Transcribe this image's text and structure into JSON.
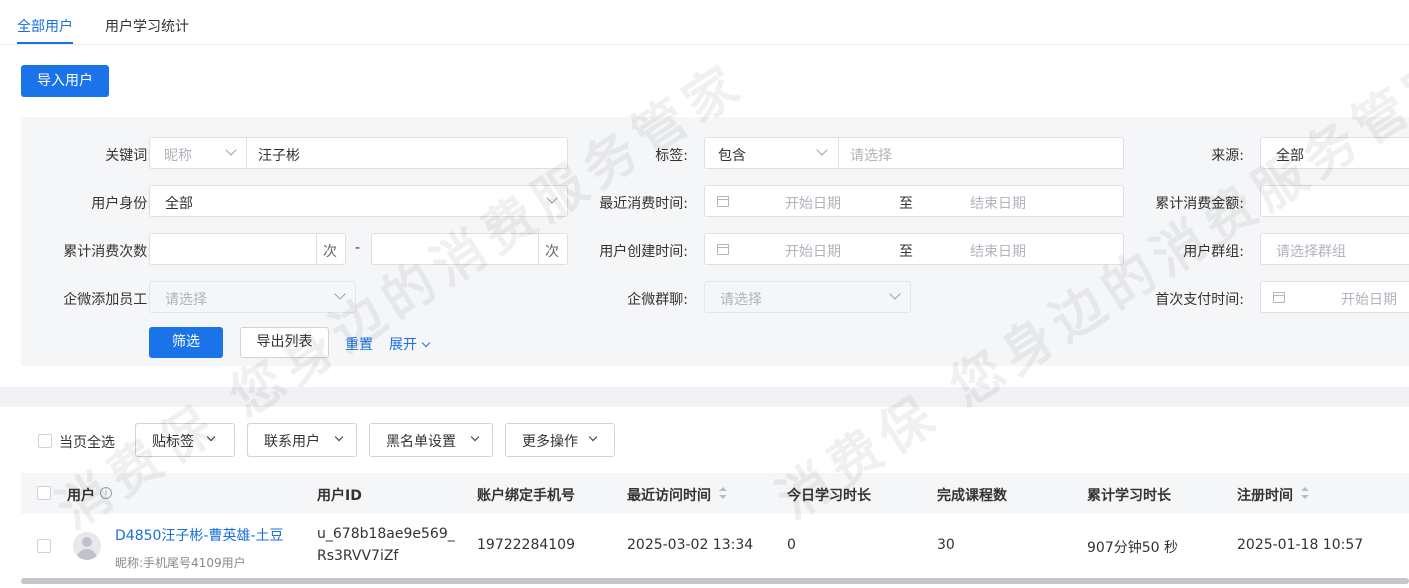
{
  "tabs": [
    {
      "label": "全部用户",
      "active": true
    },
    {
      "label": "用户学习统计",
      "active": false
    }
  ],
  "import_button": "导入用户",
  "filters": {
    "keyword": {
      "label": "关键词:",
      "type_value": "昵称",
      "value": "汪子彬"
    },
    "tag": {
      "label": "标签:",
      "mode": "包含",
      "placeholder": "请选择"
    },
    "source": {
      "label": "来源:",
      "value": "全部"
    },
    "identity": {
      "label": "用户身份:",
      "value": "全部"
    },
    "last_consume_time": {
      "label": "最近消费时间:",
      "start": "开始日期",
      "sep": "至",
      "end": "结束日期"
    },
    "total_consume_amount": {
      "label": "累计消费金额:"
    },
    "total_consume_count": {
      "label": "累计消费次数:",
      "unit": "次",
      "dash": "-"
    },
    "user_created_time": {
      "label": "用户创建时间:",
      "start": "开始日期",
      "sep": "至",
      "end": "结束日期"
    },
    "user_group": {
      "label": "用户群组:",
      "placeholder": "请选择群组"
    },
    "wecom_staff": {
      "label": "企微添加员工:",
      "placeholder": "请选择"
    },
    "wecom_group": {
      "label": "企微群聊:",
      "placeholder": "请选择"
    },
    "first_pay_time": {
      "label": "首次支付时间:",
      "start": "开始日期"
    }
  },
  "actions": {
    "filter": "筛选",
    "export": "导出列表",
    "reset": "重置",
    "expand": "展开"
  },
  "bulk": {
    "select_page": "当页全选",
    "tag": "贴标签",
    "contact": "联系用户",
    "blacklist": "黑名单设置",
    "more": "更多操作"
  },
  "table": {
    "headers": {
      "user": "用户",
      "user_id": "用户ID",
      "phone": "账户绑定手机号",
      "last_visit": "最近访问时间",
      "today_study": "今日学习时长",
      "courses_done": "完成课程数",
      "total_study": "累计学习时长",
      "register_time": "注册时间"
    },
    "rows": [
      {
        "name": "D4850汪子彬-曹英雄-土豆",
        "nickname": "昵称:手机尾号4109用户",
        "user_id_1": "u_678b18ae9e569_",
        "user_id_2": "Rs3RVV7iZf",
        "phone": "19722284109",
        "last_visit": "2025-03-02 13:34",
        "today_study": "0",
        "courses_done": "30",
        "total_study": "907分钟50 秒",
        "register_time": "2025-01-18 10:57"
      }
    ]
  },
  "watermark": "消费保 您身边的消费服务管家",
  "colors": {
    "accent": "#1a73e8",
    "link": "#1a6fe0"
  },
  "icons": [
    "chevron-down-icon",
    "calendar-icon",
    "info-icon",
    "sort-icon",
    "avatar-icon"
  ]
}
